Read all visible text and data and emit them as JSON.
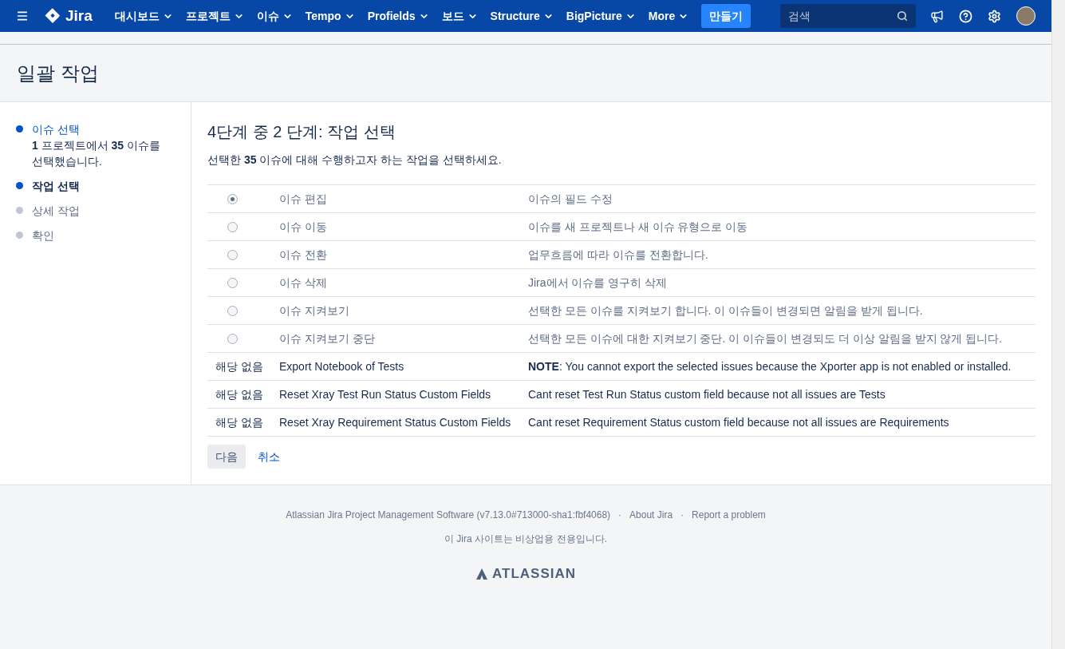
{
  "header": {
    "logo_text": "Jira",
    "nav": [
      {
        "label": "대시보드",
        "dropdown": true
      },
      {
        "label": "프로젝트",
        "dropdown": true
      },
      {
        "label": "이슈",
        "dropdown": true
      },
      {
        "label": "Tempo",
        "dropdown": true
      },
      {
        "label": "Profields",
        "dropdown": true
      },
      {
        "label": "보드",
        "dropdown": true
      },
      {
        "label": "Structure",
        "dropdown": true
      },
      {
        "label": "BigPicture",
        "dropdown": true
      },
      {
        "label": "More",
        "dropdown": true
      }
    ],
    "create_button": "만들기",
    "search": {
      "placeholder": "검색"
    }
  },
  "page_title": "일괄 작업",
  "steps": [
    {
      "label": "이슈 선택",
      "completed": true,
      "selected": false,
      "detail": "**1** 프로젝트에서 **35** 이슈를 선택했습니다."
    },
    {
      "label": "작업 선택",
      "completed": false,
      "selected": true
    },
    {
      "label": "상세 작업",
      "completed": false,
      "selected": false
    },
    {
      "label": "확인",
      "completed": false,
      "selected": false
    }
  ],
  "heading": "4단계 중 2 단계: 작업 선택",
  "description": "선택한 **35** 이슈에 대해 수행하고자 하는 작업을 선택하세요.",
  "operations": [
    {
      "kind": "radio",
      "selected": true,
      "name": "이슈 편집",
      "description": "이슈의 필드 수정"
    },
    {
      "kind": "radio",
      "selected": false,
      "name": "이슈 이동",
      "description": "이슈를 새 프로젝트나 새 이슈 유형으로 이동"
    },
    {
      "kind": "radio",
      "selected": false,
      "name": "이슈 전환",
      "description": "업무흐름에 따라 이슈를 전환합니다."
    },
    {
      "kind": "radio",
      "selected": false,
      "name": "이슈 삭제",
      "description": "Jira에서 이슈를 영구히 삭제"
    },
    {
      "kind": "radio",
      "selected": false,
      "name": "이슈 지켜보기",
      "description": "선택한 모든 이슈를 지켜보기 합니다. 이 이슈들이 변경되면 알림을 받게 됩니다."
    },
    {
      "kind": "radio",
      "selected": false,
      "name": "이슈 지켜보기 중단",
      "description": "선택한 모든 이슈에 대한 지켜보기 중단. 이 이슈들이 변경되도 더 이상 알림을 받지 않게 됩니다."
    },
    {
      "kind": "unavailable",
      "status": "해당 없음",
      "name": "Export Notebook of Tests",
      "description": "**NOTE**: You cannot export the selected issues because the Xporter app is not enabled or installed."
    },
    {
      "kind": "unavailable",
      "status": "해당 없음",
      "name": "Reset Xray Test Run Status Custom Fields",
      "description": "Cant reset Test Run Status custom field because not all issues are Tests"
    },
    {
      "kind": "unavailable",
      "status": "해당 없음",
      "name": "Reset Xray Requirement Status Custom Fields",
      "description": "Cant reset Requirement Status custom field because not all issues are Requirements"
    }
  ],
  "buttons": {
    "next": "다음",
    "cancel": "취소"
  },
  "footer": {
    "links": [
      "Atlassian Jira Project Management Software (v7.13.0#713000-sha1:fbf4068)",
      "About Jira",
      "Report a problem"
    ],
    "separator": "·",
    "notice": "이 Jira 사이트는 비상업용 전용입니다.",
    "brand": "ATLASSIAN"
  }
}
